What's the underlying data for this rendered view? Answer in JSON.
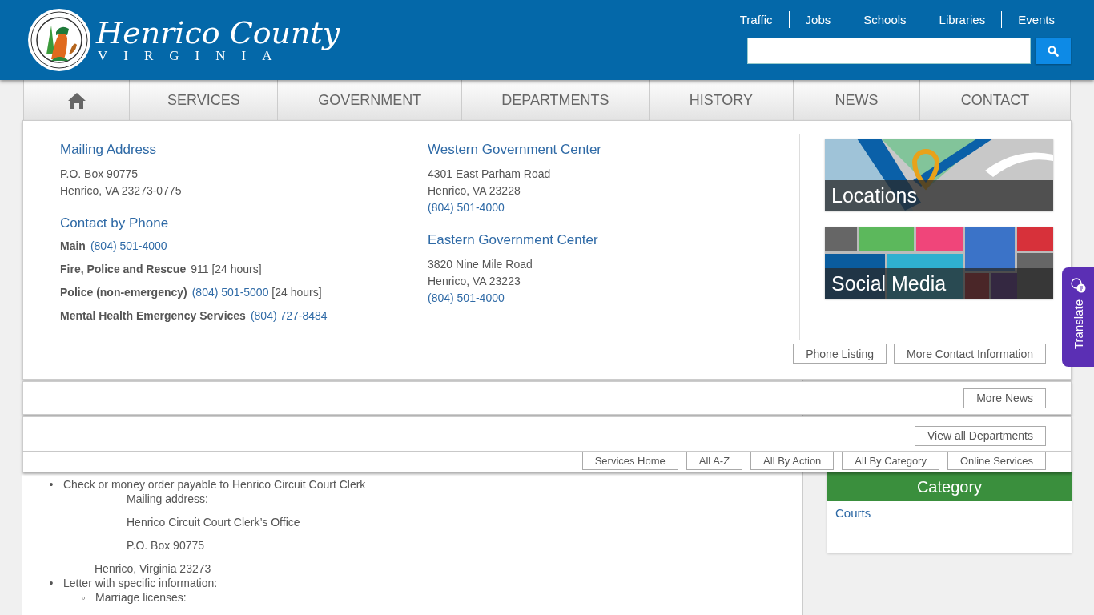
{
  "header": {
    "logo_title": "Henrico County",
    "logo_subtitle": "VIRGINIA",
    "utility_links": [
      "Traffic",
      "Jobs",
      "Schools",
      "Libraries",
      "Events"
    ]
  },
  "nav": [
    {
      "kind": "home"
    },
    {
      "kind": "text",
      "label": "SERVICES"
    },
    {
      "kind": "text",
      "label": "GOVERNMENT"
    },
    {
      "kind": "text",
      "label": "DEPARTMENTS"
    },
    {
      "kind": "text",
      "label": "HISTORY"
    },
    {
      "kind": "text",
      "label": "NEWS"
    },
    {
      "kind": "text",
      "label": "CONTACT"
    }
  ],
  "contact_menu": {
    "mailing": {
      "heading": "Mailing Address",
      "lines": [
        "P.O. Box 90775",
        "Henrico, VA 23273-0775"
      ]
    },
    "phone": {
      "heading": "Contact by Phone",
      "entries": [
        {
          "label": "Main",
          "number": "(804) 501-4000"
        },
        {
          "label": "Fire, Police and Rescue",
          "note": "911 [24 hours]"
        },
        {
          "label": "Police (non-emergency)",
          "number": "(804) 501-5000",
          "note": "[24 hours]"
        },
        {
          "label": "Mental Health Emergency Services",
          "number": "(804) 727-8484"
        }
      ]
    },
    "centers": [
      {
        "heading": "Western Government Center",
        "lines": [
          "4301 East Parham Road",
          "Henrico, VA 23228"
        ],
        "phone": "(804) 501-4000"
      },
      {
        "heading": "Eastern Government Center",
        "lines": [
          "3820 Nine Mile Road",
          "Henrico, VA 23223"
        ],
        "phone": "(804) 501-4000"
      }
    ],
    "tiles": [
      {
        "kind": "map",
        "label": "Locations"
      },
      {
        "kind": "social",
        "label": "Social Media"
      }
    ],
    "buttons": [
      "Phone Listing",
      "More Contact Information"
    ]
  },
  "news_menu": {
    "buttons": [
      "More News"
    ]
  },
  "departments_menu": {
    "buttons": [
      "View all Departments"
    ]
  },
  "services_menu": {
    "buttons": [
      "Services Home",
      "All A-Z",
      "All By Action",
      "All By Category",
      "Online Services"
    ]
  },
  "content": {
    "items": [
      {
        "marker": "•",
        "text": "Check or money order payable to Henrico Circuit Court Clerk",
        "address_lines": [
          "Mailing address:",
          "Henrico Circuit Court Clerk’s Office",
          "P.O. Box 90775"
        ],
        "city_line": "Henrico, Virginia 23273"
      },
      {
        "marker": "•",
        "text": "Letter with specific information:",
        "subitems": [
          {
            "marker": "◦",
            "text": "Marriage licenses:"
          }
        ]
      }
    ]
  },
  "sidebar": {
    "category": {
      "title": "Category",
      "links": [
        "Courts"
      ]
    }
  },
  "translate": {
    "label": "Translate"
  }
}
